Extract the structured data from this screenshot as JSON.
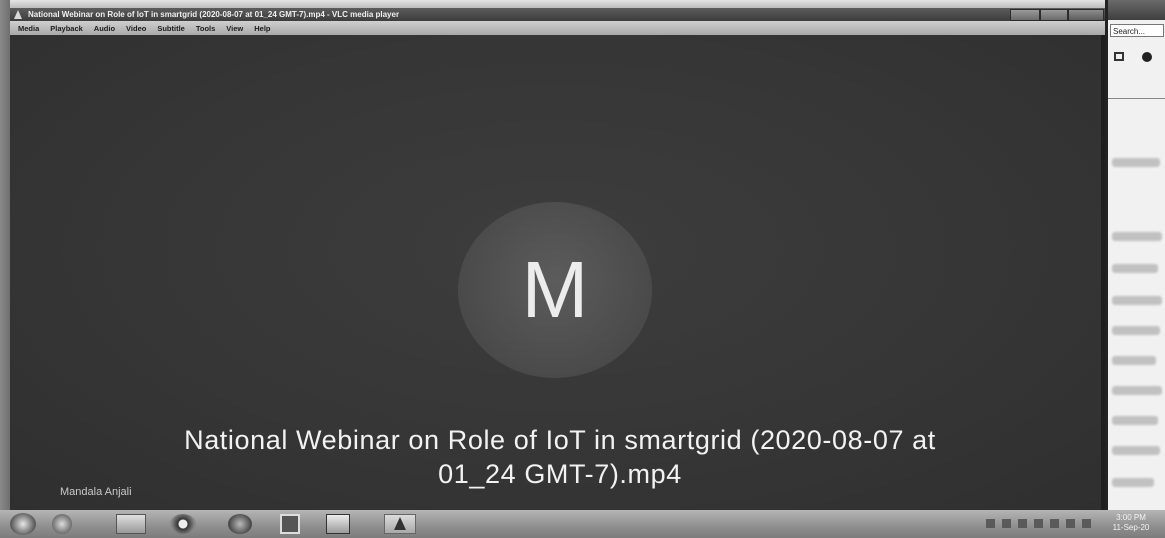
{
  "window": {
    "title": "National Webinar on Role of IoT in smartgrid (2020-08-07 at 01_24 GMT-7).mp4 - VLC media player",
    "app_icon": "vlc-cone-icon",
    "minimize_label": "",
    "maximize_label": "",
    "close_label": ""
  },
  "menu": [
    "Media",
    "Playback",
    "Audio",
    "Video",
    "Subtitle",
    "Tools",
    "View",
    "Help"
  ],
  "video": {
    "avatar_letter": "M",
    "caption_line1": "National Webinar on Role of IoT in smartgrid (2020-08-07 at",
    "caption_line2": "01_24 GMT-7).mp4",
    "participant_name": "Mandala Anjali"
  },
  "side_window": {
    "search_label": "Search..."
  },
  "taskbar": {
    "clock_time": "3:00 PM",
    "clock_date": "11-Sep-20",
    "icons": [
      "start-orb-icon",
      "internet-explorer-icon",
      "folder-icon",
      "chrome-icon",
      "app-icon",
      "media-player-icon",
      "document-icon",
      "vlc-cone-icon"
    ]
  },
  "colors": {
    "video_background": "#363636",
    "avatar_circle": "#555555",
    "caption_text": "#f2f2f2",
    "titlebar": "#4a4a4a",
    "menubar": "#bdbdbd"
  }
}
